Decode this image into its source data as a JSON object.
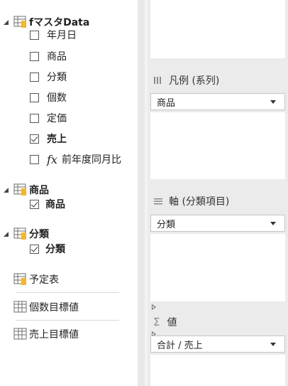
{
  "fields_tree": {
    "tables": [
      {
        "name": "fマスタData",
        "fields": [
          {
            "label": "年月日",
            "checked": false
          },
          {
            "label": "商品",
            "checked": false
          },
          {
            "label": "分類",
            "checked": false
          },
          {
            "label": "個数",
            "checked": false
          },
          {
            "label": "定価",
            "checked": false
          },
          {
            "label": "売上",
            "checked": true
          },
          {
            "label": "前年度同月比",
            "checked": false,
            "measure_glyph": "fx"
          }
        ]
      },
      {
        "name": "商品",
        "fields": [
          {
            "label": "商品",
            "checked": true
          }
        ]
      },
      {
        "name": "分類",
        "fields": [
          {
            "label": "分類",
            "checked": true
          }
        ]
      },
      {
        "name": "予定表"
      },
      {
        "name": "個数目標値"
      },
      {
        "name": "売上目標値"
      }
    ]
  },
  "wells": {
    "legend": {
      "title": "凡例 (系列)",
      "value": "商品"
    },
    "axis": {
      "title": "軸 (分類項目)",
      "value": "分類"
    },
    "values": {
      "title": "値",
      "icon_glyph": "Σ",
      "value": "合計 / 売上"
    }
  },
  "icons": [
    "expand-triangle-icon",
    "collapse-triangle-icon",
    "table-icon",
    "checkbox-icon",
    "fx-measure-icon",
    "legend-bars-icon",
    "axis-lines-icon",
    "sigma-icon",
    "dropdown-caret-icon"
  ],
  "colors": {
    "table_header": "#f2b632",
    "panel_bg": "#ebebeb",
    "border": "#c6c6c6"
  }
}
